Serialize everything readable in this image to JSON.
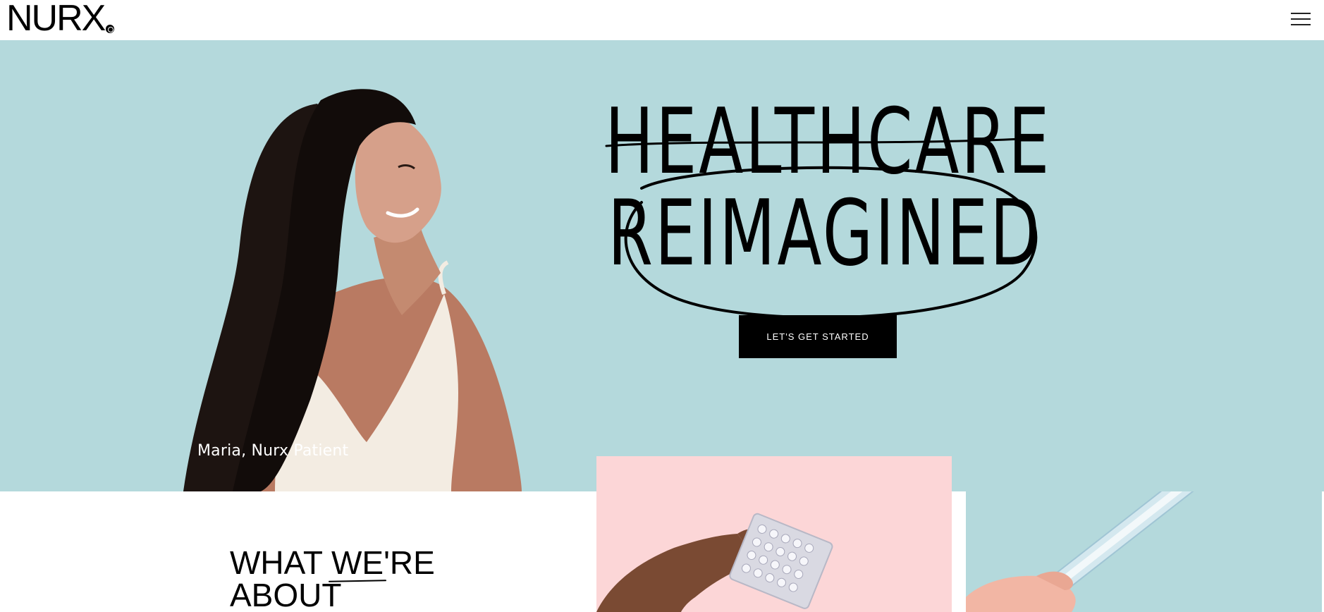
{
  "header": {
    "logo_text": "NURX",
    "menu_icon": "hamburger-menu-icon"
  },
  "hero": {
    "background_color": "#b4d9dc",
    "headline_line1": "HEALTHCARE",
    "headline_line2": "REIMAGINED",
    "cta_label": "LET'S GET STARTED",
    "caption": "Maria, Nurx Patient"
  },
  "about": {
    "heading_word1": "WHAT",
    "heading_word2": "WE",
    "heading_word3": "'RE",
    "heading_line2": "ABOUT"
  },
  "cards": {
    "pink_color": "#fcd6d7",
    "blue_color": "#b4d9dc",
    "pink_image": "hand-holding-pill-pack",
    "blue_image": "hand-holding-test-tube"
  }
}
